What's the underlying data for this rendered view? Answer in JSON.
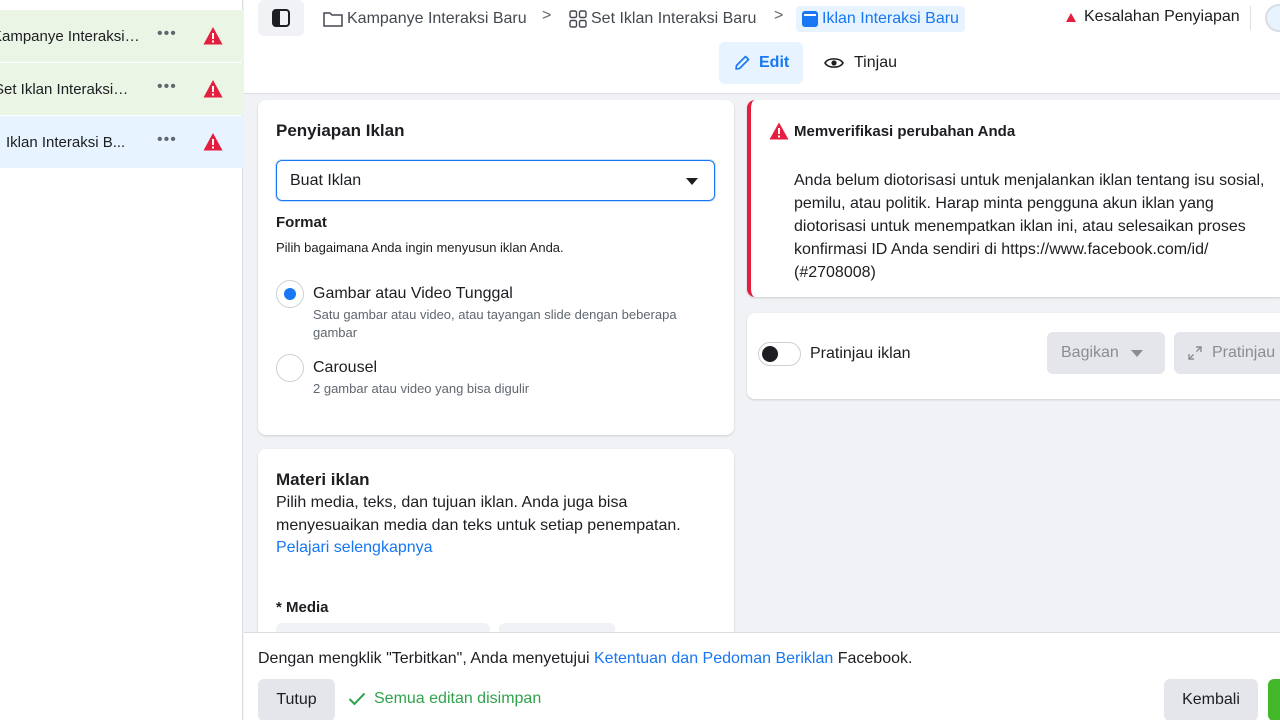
{
  "sidebar": {
    "items": [
      {
        "label": "Kampanye Interaksi B...",
        "more": "•••",
        "status": "error"
      },
      {
        "label": "Set Iklan Interaksi ...",
        "more": "•••",
        "status": "error"
      },
      {
        "label": "Iklan Interaksi B...",
        "more": "•••",
        "status": "error"
      }
    ]
  },
  "header": {
    "breadcrumb": [
      {
        "label": "Kampanye Interaksi Baru",
        "icon": "folder-icon"
      },
      {
        "label": "Set Iklan Interaksi Baru",
        "icon": "grid-icon"
      },
      {
        "label": "Iklan Interaksi Baru",
        "icon": "ad-icon"
      }
    ],
    "separator": ">",
    "error_label": "Kesalahan Penyiapan",
    "tabs": {
      "edit": "Edit",
      "review": "Tinjau"
    }
  },
  "setup": {
    "title": "Penyiapan Iklan",
    "select_value": "Buat Iklan",
    "format_title": "Format",
    "format_desc": "Pilih bagaimana Anda ingin menyusun iklan Anda.",
    "options": [
      {
        "title": "Gambar atau Video Tunggal",
        "desc": "Satu gambar atau video, atau tayangan slide dengan beberapa gambar",
        "selected": true
      },
      {
        "title": "Carousel",
        "desc": "2 gambar atau video yang bisa digulir",
        "selected": false
      }
    ]
  },
  "materi": {
    "title": "Materi iklan",
    "desc": "Pilih media, teks, dan tujuan iklan. Anda juga bisa menyesuaikan media dan teks untuk setiap penempatan.",
    "link": "Pelajari selengkapnya",
    "media_label": "* Media"
  },
  "verify": {
    "title": "Memverifikasi perubahan Anda",
    "body": "Anda belum diotorisasi untuk menjalankan iklan tentang isu sosial, pemilu, atau politik. Harap minta pengguna akun iklan yang diotorisasi untuk menempatkan iklan ini, atau selesaikan proses konfirmasi ID Anda sendiri di https://www.facebook.com/id/ (#2708008)"
  },
  "preview": {
    "toggle_label": "Pratinjau iklan",
    "share_label": "Bagikan",
    "preview_label": "Pratinjau"
  },
  "footer": {
    "terms_prefix": "Dengan mengklik \"Terbitkan\", Anda menyetujui ",
    "terms_link": "Ketentuan dan Pedoman Beriklan",
    "terms_suffix": " Facebook.",
    "close_label": "Tutup",
    "saved_label": "Semua editan disimpan",
    "back_label": "Kembali"
  },
  "colors": {
    "accent": "#1877f2",
    "error": "#e41e3f",
    "success": "#42b72a",
    "campaign_bg": "#ebf5e6",
    "selected_bg": "#e7f3ff"
  }
}
